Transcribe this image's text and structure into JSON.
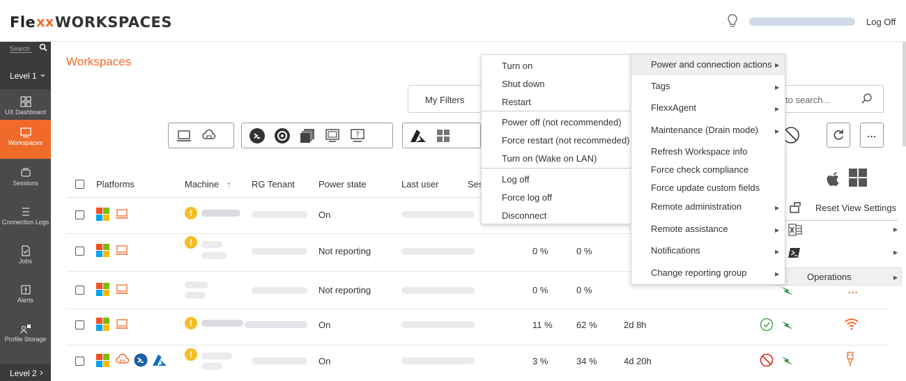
{
  "header": {
    "logo_a": "Fle",
    "logo_b": "xx",
    "logo_c": "WORKSPACES",
    "logoff": "Log Off"
  },
  "sidebar": {
    "search_placeholder": "Search",
    "level1": "Level 1",
    "level2": "Level 2",
    "items": [
      {
        "label": "UX Dashboard",
        "icon": "dashboard-icon"
      },
      {
        "label": "Workspaces",
        "icon": "monitor-icon"
      },
      {
        "label": "Sessions",
        "icon": "sessions-icon"
      },
      {
        "label": "Connection Logs",
        "icon": "list-icon"
      },
      {
        "label": "Jobs",
        "icon": "jobs-icon"
      },
      {
        "label": "Alerts",
        "icon": "alert-icon"
      },
      {
        "label": "Profile Storage",
        "icon": "profile-storage-icon"
      }
    ]
  },
  "page": {
    "title": "Workspaces",
    "my_filters": "My Filters",
    "search_placeholder": "to search..."
  },
  "table": {
    "headers": {
      "platforms": "Platforms",
      "machine": "Machine",
      "sort": "↑",
      "rg_tenant": "RG Tenant",
      "power_state": "Power state",
      "last_user": "Last user",
      "ses": "Ses"
    },
    "rows": [
      {
        "power": "On",
        "cpu": "",
        "mem": "",
        "uptime": ""
      },
      {
        "power": "Not reporting",
        "cpu": "0 %",
        "mem": "0 %",
        "uptime": ""
      },
      {
        "power": "Not reporting",
        "cpu": "0 %",
        "mem": "0 %",
        "uptime": ""
      },
      {
        "power": "On",
        "cpu": "11 %",
        "mem": "62 %",
        "uptime": "2d 8h"
      },
      {
        "power": "On",
        "cpu": "3 %",
        "mem": "34 %",
        "uptime": "4d 20h"
      }
    ]
  },
  "submenu_power": {
    "items": [
      "Turn on",
      "Shut down",
      "Restart",
      "Power off (not recommended)",
      "Force restart (not recommeded)",
      "Turn on (Wake on LAN)",
      "Log off",
      "Force log off",
      "Disconnect"
    ]
  },
  "menu_main": {
    "items": [
      "Power and connection actions",
      "Tags",
      "FlexxAgent",
      "Maintenance (Drain mode)",
      "Refresh Workspace info",
      "Force check compliance",
      "Force update custom fields",
      "Remote administration",
      "Remote assistance",
      "Notifications",
      "Change reporting group"
    ]
  },
  "right_menu": {
    "reset_view": "Reset View Settings",
    "operations": "Operations",
    "more": "..."
  },
  "colors": {
    "accent": "#f06a2a",
    "sidebar": "#4a4a4a",
    "sidebar_dark": "#3b3b3b"
  }
}
